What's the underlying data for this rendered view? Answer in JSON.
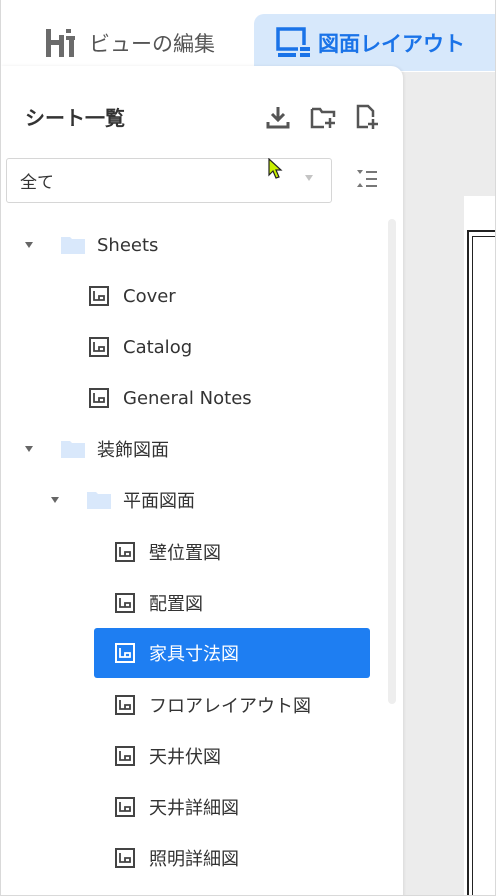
{
  "tabs": {
    "edit_label": "ビューの編集",
    "layout_label": "図面レイアウト"
  },
  "panel": {
    "title": "シート一覧",
    "filter_value": "全て"
  },
  "tree": {
    "folder1": "Sheets",
    "folder1_items": [
      "Cover",
      "Catalog",
      "General Notes"
    ],
    "folder2": "装飾図面",
    "subfolder": "平面図面",
    "sub_items": [
      "壁位置図",
      "配置図",
      "家具寸法図",
      "フロアレイアウト図",
      "天井伏図",
      "天井詳細図",
      "照明詳細図"
    ]
  },
  "colors": {
    "accent": "#1e7ef2",
    "tab_active_bg": "#d7e8fb",
    "folder": "#d9e8fb"
  }
}
